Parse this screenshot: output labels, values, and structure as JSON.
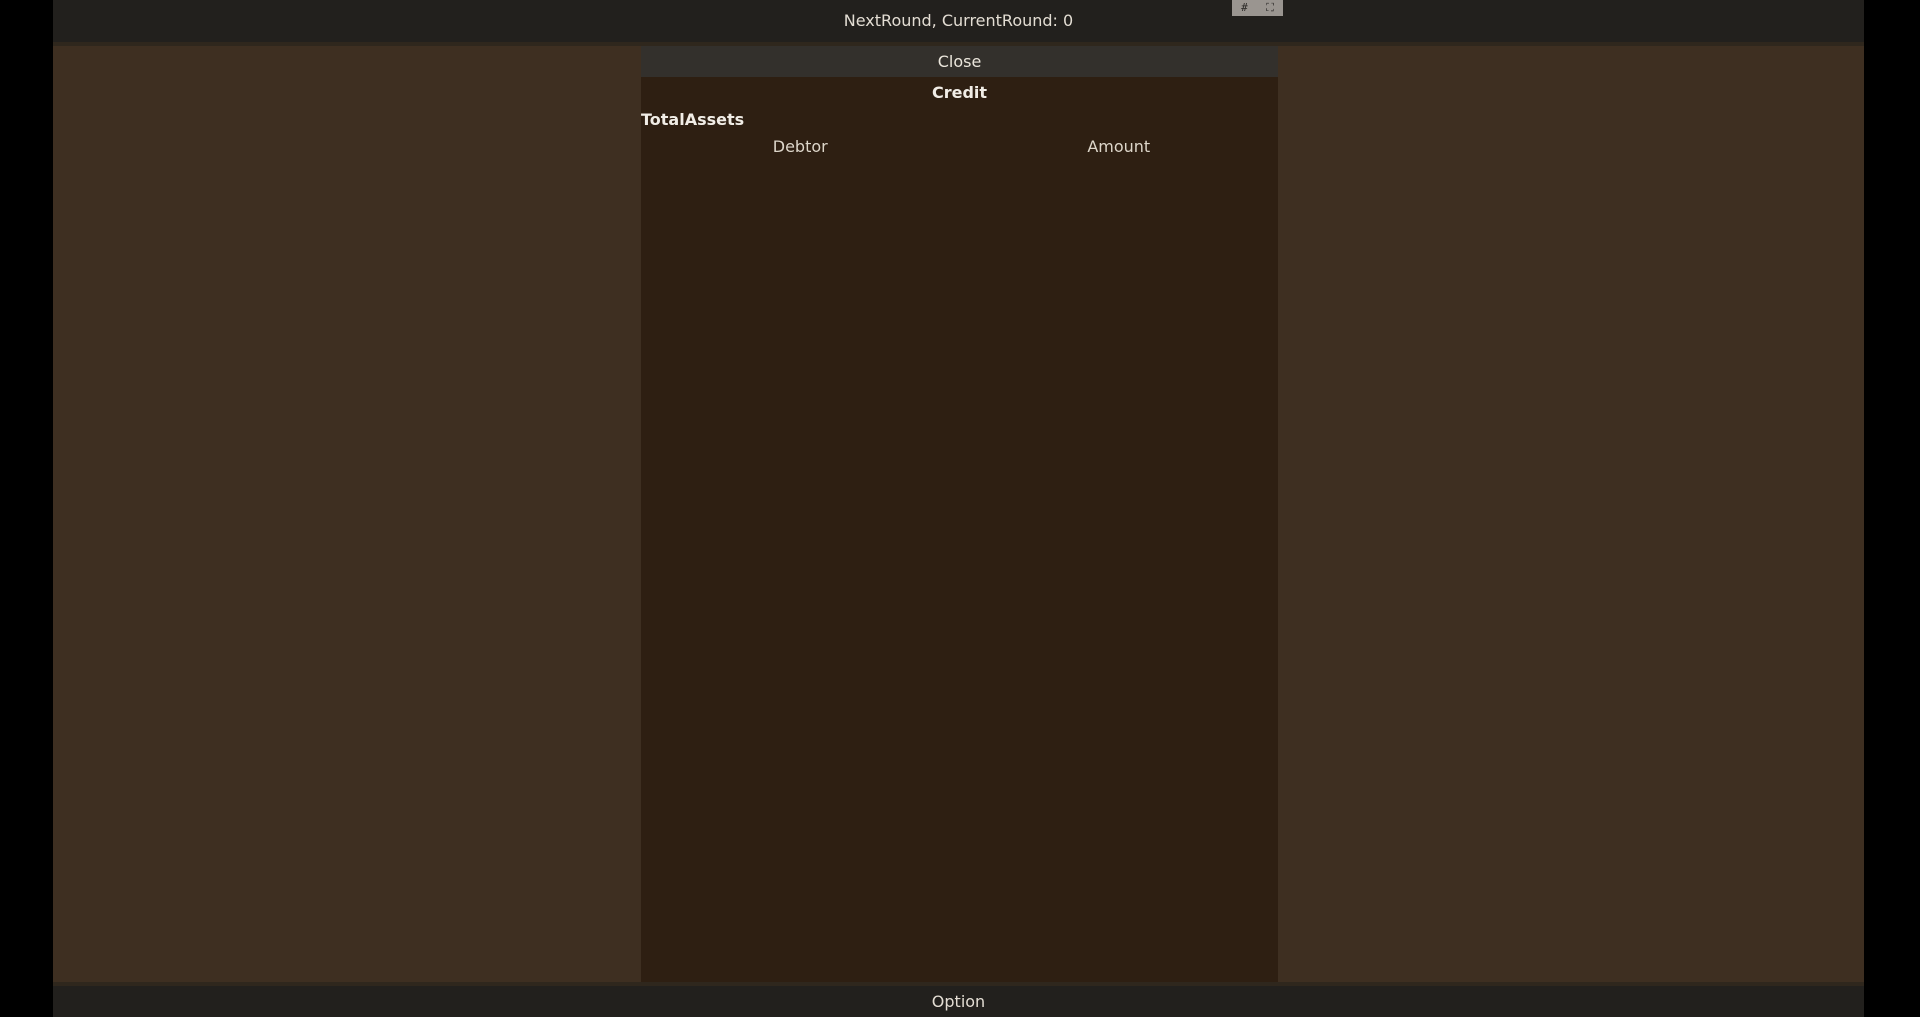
{
  "top_bar": {
    "label": "NextRound, CurrentRound: 0"
  },
  "window_controls": {
    "grid_icon": "#",
    "expand_icon": "⛶"
  },
  "panel": {
    "close_label": "Close",
    "title": "Credit",
    "total_assets_label": "TotalAssets",
    "table": {
      "columns": [
        "Debtor",
        "Amount"
      ],
      "rows": []
    }
  },
  "bottom_bar": {
    "label": "Option"
  }
}
